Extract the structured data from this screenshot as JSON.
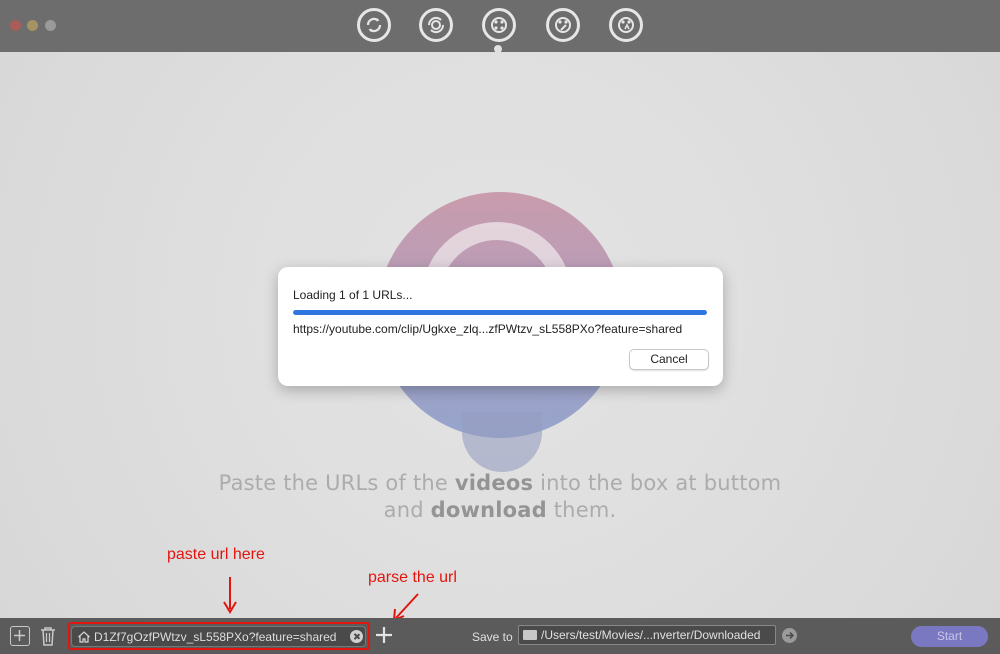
{
  "toolbar": {
    "icons": [
      "convert-icon",
      "rotate-convert-icon",
      "video-download-icon",
      "video-edit-icon",
      "video-effects-icon"
    ]
  },
  "main": {
    "tagline_line1_pre": "Paste the URLs of the ",
    "tagline_line1_bold": "videos",
    "tagline_line1_post": " into the box at buttom",
    "tagline_line2_pre": "and ",
    "tagline_line2_bold": "download",
    "tagline_line2_post": " them."
  },
  "dialog": {
    "title": "Loading 1 of 1 URLs...",
    "progress": 1.0,
    "url": "https://youtube.com/clip/Ugkxe_zlq...zfPWtzv_sL558PXo?feature=shared",
    "cancel_label": "Cancel"
  },
  "annotations": {
    "paste_label": "paste url here",
    "parse_label": "parse the url"
  },
  "bottom_bar": {
    "url_input_value": "D1Zf7gOzfPWtzv_sL558PXo?feature=shared",
    "save_to_label": "Save to",
    "save_path": "/Users/test/Movies/...nverter/Downloaded",
    "start_label": "Start"
  },
  "colors": {
    "accent": "#2f76e0",
    "annotation": "#e3160f",
    "start_button": "#7b78c2"
  }
}
